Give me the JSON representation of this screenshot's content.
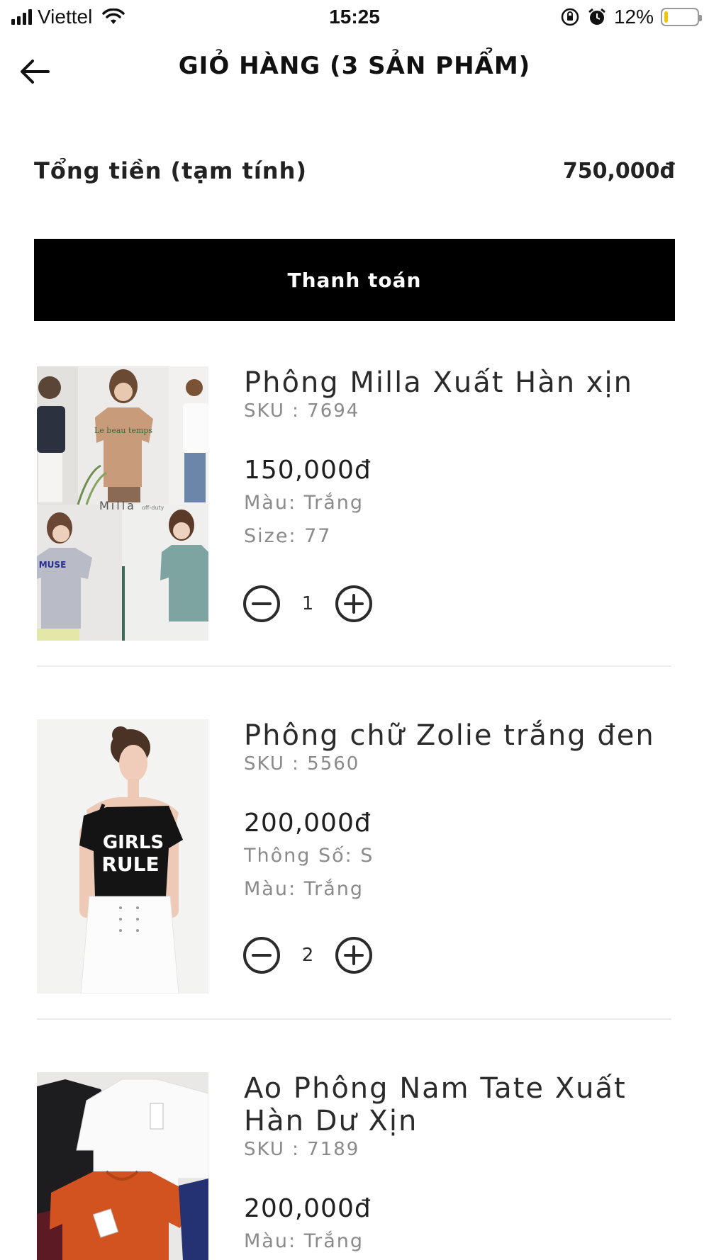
{
  "status_bar": {
    "carrier": "Viettel",
    "time": "15:25",
    "battery_percent_label": "12%",
    "battery_level": 0.12,
    "signal_icon": "signal-bars-icon",
    "wifi_icon": "wifi-icon",
    "rotation_lock_icon": "rotation-lock-icon",
    "alarm_icon": "alarm-clock-icon",
    "battery_color": "#f5c400"
  },
  "header": {
    "title": "GIỎ HÀNG (3 SẢN PHẨM)",
    "back_icon": "arrow-left-icon"
  },
  "summary": {
    "total_label": "Tổng tiền (tạm tính)",
    "total_value": "750,000đ"
  },
  "checkout": {
    "label": "Thanh toán",
    "background": "#000000"
  },
  "items": [
    {
      "name": "Phông Milla Xuất Hàn xịn",
      "sku": "SKU : 7694",
      "price": "150,000đ",
      "attr1": "Màu: Trắng",
      "attr2": "Size: 77",
      "quantity": "1",
      "image_text": "Milla",
      "image_text2": "off-duty",
      "shirt_text_1": "Le beau temps",
      "shirt_text_2": "MUSE"
    },
    {
      "name": "Phông chữ Zolie trắng đen",
      "sku": "SKU : 5560",
      "price": "200,000đ",
      "attr1": "Thông Số: S",
      "attr2": "Màu: Trắng",
      "quantity": "2",
      "shirt_text_1": "GIRLS",
      "shirt_text_2": "RULE"
    },
    {
      "name": "Ao Phông Nam Tate Xuất Hàn Dư Xịn",
      "sku": "SKU : 7189",
      "price": "200,000đ",
      "attr1": "Màu: Trắng"
    }
  ],
  "qty_icons": {
    "minus": "minus-circle-icon",
    "plus": "plus-circle-icon"
  }
}
